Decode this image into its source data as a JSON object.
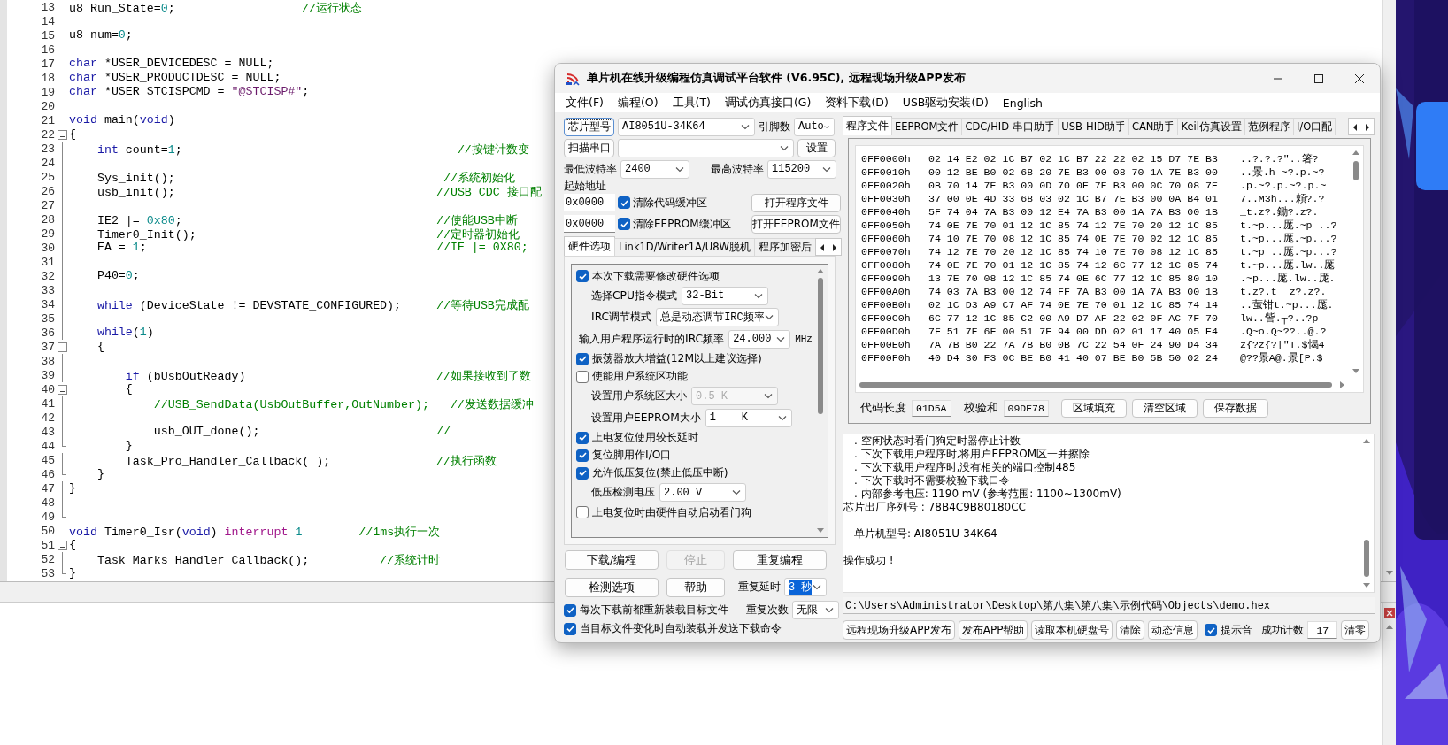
{
  "editor": {
    "lines": [
      {
        "number": "13",
        "tokens": [
          {
            "kind": "plain",
            "text": "u8 Run_State="
          },
          {
            "kind": "num",
            "text": "0"
          },
          {
            "kind": "plain",
            "text": ";                  "
          },
          {
            "kind": "comment",
            "text": "//运行状态"
          }
        ]
      },
      {
        "number": "14"
      },
      {
        "number": "15",
        "tokens": [
          {
            "kind": "plain",
            "text": "u8 num="
          },
          {
            "kind": "num",
            "text": "0"
          },
          {
            "kind": "plain",
            "text": ";"
          }
        ]
      },
      {
        "number": "16"
      },
      {
        "number": "17",
        "tokens": [
          {
            "kind": "kw",
            "text": "char"
          },
          {
            "kind": "plain",
            "text": " *USER_DEVICEDESC = NULL;"
          }
        ]
      },
      {
        "number": "18",
        "tokens": [
          {
            "kind": "kw",
            "text": "char"
          },
          {
            "kind": "plain",
            "text": " *USER_PRODUCTDESC = NULL;"
          }
        ]
      },
      {
        "number": "19",
        "tokens": [
          {
            "kind": "kw",
            "text": "char"
          },
          {
            "kind": "plain",
            "text": " *USER_STCISPCMD = "
          },
          {
            "kind": "str",
            "text": "\"@STCISP#\""
          },
          {
            "kind": "plain",
            "text": ";"
          }
        ]
      },
      {
        "number": "20"
      },
      {
        "number": "21",
        "tokens": [
          {
            "kind": "kw",
            "text": "void"
          },
          {
            "kind": "plain",
            "text": " main("
          },
          {
            "kind": "kw",
            "text": "void"
          },
          {
            "kind": "plain",
            "text": ")"
          }
        ]
      },
      {
        "number": "22",
        "kind": "open",
        "tokens": [
          {
            "kind": "plain",
            "text": "{"
          }
        ]
      },
      {
        "number": "23",
        "kind": "inside",
        "tokens": [
          {
            "kind": "kw",
            "text": "    int"
          },
          {
            "kind": "plain",
            "text": " count="
          },
          {
            "kind": "num",
            "text": "1"
          },
          {
            "kind": "plain",
            "text": ";                                       "
          },
          {
            "kind": "comment",
            "text": "//按键计数变"
          }
        ]
      },
      {
        "number": "24",
        "kind": "inside"
      },
      {
        "number": "25",
        "kind": "inside",
        "tokens": [
          {
            "kind": "plain",
            "text": "    Sys_init();                                      "
          },
          {
            "kind": "comment",
            "text": "//系统初始化"
          }
        ]
      },
      {
        "number": "26",
        "kind": "inside",
        "tokens": [
          {
            "kind": "plain",
            "text": "    usb_init();                                     "
          },
          {
            "kind": "comment",
            "text": "//USB CDC 接口配"
          }
        ]
      },
      {
        "number": "27",
        "kind": "inside"
      },
      {
        "number": "28",
        "kind": "inside",
        "tokens": [
          {
            "kind": "plain",
            "text": "    IE2 |= "
          },
          {
            "kind": "num",
            "text": "0x80"
          },
          {
            "kind": "plain",
            "text": ";                                    "
          },
          {
            "kind": "comment",
            "text": "//使能USB中断"
          }
        ]
      },
      {
        "number": "29",
        "kind": "inside",
        "tokens": [
          {
            "kind": "plain",
            "text": "    Timer0_Init();                                  "
          },
          {
            "kind": "comment",
            "text": "//定时器初始化"
          }
        ]
      },
      {
        "number": "30",
        "kind": "inside",
        "tokens": [
          {
            "kind": "plain",
            "text": "    EA = "
          },
          {
            "kind": "num",
            "text": "1"
          },
          {
            "kind": "plain",
            "text": ";                                         "
          },
          {
            "kind": "comment",
            "text": "//IE |= 0X80;"
          }
        ]
      },
      {
        "number": "31",
        "kind": "inside"
      },
      {
        "number": "32",
        "kind": "inside",
        "tokens": [
          {
            "kind": "plain",
            "text": "    P40="
          },
          {
            "kind": "num",
            "text": "0"
          },
          {
            "kind": "plain",
            "text": ";"
          }
        ]
      },
      {
        "number": "33",
        "kind": "inside"
      },
      {
        "number": "34",
        "kind": "inside",
        "tokens": [
          {
            "kind": "kw",
            "text": "    while"
          },
          {
            "kind": "plain",
            "text": " (DeviceState != DEVSTATE_CONFIGURED);     "
          },
          {
            "kind": "comment",
            "text": "//等待USB完成配"
          }
        ]
      },
      {
        "number": "35",
        "kind": "inside"
      },
      {
        "number": "36",
        "kind": "inside",
        "tokens": [
          {
            "kind": "kw",
            "text": "    while"
          },
          {
            "kind": "plain",
            "text": "("
          },
          {
            "kind": "num",
            "text": "1"
          },
          {
            "kind": "plain",
            "text": ")"
          }
        ]
      },
      {
        "number": "37",
        "kind": "open",
        "tokens": [
          {
            "kind": "plain",
            "text": "    {"
          }
        ]
      },
      {
        "number": "38",
        "kind": "inside"
      },
      {
        "number": "39",
        "kind": "inside",
        "tokens": [
          {
            "kind": "kw",
            "text": "        if"
          },
          {
            "kind": "plain",
            "text": " (bUsbOutReady)                           "
          },
          {
            "kind": "comment",
            "text": "//如果接收到了数"
          }
        ]
      },
      {
        "number": "40",
        "kind": "open",
        "tokens": [
          {
            "kind": "plain",
            "text": "        {"
          }
        ]
      },
      {
        "number": "41",
        "kind": "inside",
        "tokens": [
          {
            "kind": "comment",
            "text": "            //USB_SendData(UsbOutBuffer,OutNumber);   //发送数据缓冲"
          }
        ]
      },
      {
        "number": "42",
        "kind": "inside"
      },
      {
        "number": "43",
        "kind": "inside",
        "tokens": [
          {
            "kind": "plain",
            "text": "            usb_OUT_done();                         "
          },
          {
            "kind": "comment",
            "text": "//"
          }
        ]
      },
      {
        "number": "44",
        "kind": "close",
        "tokens": [
          {
            "kind": "plain",
            "text": "        }"
          }
        ]
      },
      {
        "number": "45",
        "kind": "inside",
        "tokens": [
          {
            "kind": "plain",
            "text": "        Task_Pro_Handler_Callback( );               "
          },
          {
            "kind": "comment",
            "text": "//执行函数"
          }
        ]
      },
      {
        "number": "46",
        "kind": "close",
        "tokens": [
          {
            "kind": "plain",
            "text": "    }"
          }
        ]
      },
      {
        "number": "47",
        "kind": "inside",
        "tokens": [
          {
            "kind": "plain",
            "text": "}"
          }
        ]
      },
      {
        "number": "48",
        "kind": "inside"
      },
      {
        "number": "49",
        "kind": "close"
      },
      {
        "number": "50",
        "tokens": [
          {
            "kind": "kw",
            "text": "void"
          },
          {
            "kind": "plain",
            "text": " Timer0_Isr("
          },
          {
            "kind": "kw",
            "text": "void"
          },
          {
            "kind": "plain",
            "text": ") "
          },
          {
            "kind": "kw2",
            "text": "interrupt"
          },
          {
            "kind": "num",
            "text": " 1"
          },
          {
            "kind": "comment",
            "text": "        //1ms执行一次"
          }
        ]
      },
      {
        "number": "51",
        "kind": "open",
        "tokens": [
          {
            "kind": "plain",
            "text": "{"
          }
        ]
      },
      {
        "number": "52",
        "kind": "inside",
        "tokens": [
          {
            "kind": "plain",
            "text": "    Task_Marks_Handler_Callback();          "
          },
          {
            "kind": "comment",
            "text": "//系统计时"
          }
        ]
      },
      {
        "number": "53",
        "kind": "close",
        "tokens": [
          {
            "kind": "plain",
            "text": "}"
          }
        ]
      }
    ]
  },
  "programmer": {
    "title": "单片机在线升级编程仿真调试平台软件 (V6.95C), 远程现场升级APP发布",
    "menu": [
      "文件(F)",
      "编程(O)",
      "工具(T)",
      "调试仿真接口(G)",
      "资料下载(D)",
      "USB驱动安装(D)",
      "English"
    ],
    "chip": {
      "button": "芯片型号",
      "model": "AI8051U-34K64",
      "pins_label": "引脚数",
      "pins": "Auto"
    },
    "port": {
      "button": "扫描串口",
      "settings_button": "设置"
    },
    "baud": {
      "min_label": "最低波特率",
      "min": "2400",
      "max_label": "最高波特率",
      "max": "115200"
    },
    "start_address": {
      "label": "起始地址",
      "rows": [
        {
          "address": "0x0000",
          "option": "清除代码缓冲区",
          "checked": true,
          "button": "打开程序文件"
        },
        {
          "address": "0x0000",
          "option": "清除EEPROM缓冲区",
          "checked": true,
          "button": "打开EEPROM文件"
        }
      ]
    },
    "option_tabs": [
      {
        "label": "硬件选项",
        "selected": true
      },
      {
        "label": "Link1D/Writer1A/U8W脱机",
        "selected": false
      },
      {
        "label": "程序加密后",
        "selected": false
      }
    ],
    "hardware_options": [
      {
        "kind": "checkbox",
        "label": "本次下载需要修改硬件选项",
        "checked": true
      },
      {
        "kind": "select",
        "label": "选择CPU指令模式",
        "value": "32-Bit",
        "disabled": false
      },
      {
        "kind": "select",
        "label": "IRC调节模式",
        "value": "总是动态调节IRC频率",
        "disabled": false
      },
      {
        "kind": "select",
        "label": "输入用户程序运行时的IRC频率",
        "value": "24.000",
        "unit": "MHz",
        "disabled": false
      },
      {
        "kind": "checkbox",
        "label": "振荡器放大增益(12M以上建议选择)",
        "checked": true
      },
      {
        "kind": "checkbox",
        "label": "使能用户系统区功能",
        "checked": false
      },
      {
        "kind": "select",
        "label": "设置用户系统区大小",
        "value": "0.5 K",
        "disabled": true
      },
      {
        "kind": "select",
        "label": "设置用户EEPROM大小",
        "value": "1    K",
        "disabled": false
      },
      {
        "kind": "checkbox",
        "label": "上电复位使用较长延时",
        "checked": true
      },
      {
        "kind": "checkbox",
        "label": "复位脚用作I/O口",
        "checked": true
      },
      {
        "kind": "checkbox",
        "label": "允许低压复位(禁止低压中断)",
        "checked": true
      },
      {
        "kind": "select",
        "label": "低压检测电压",
        "value": "2.00 V",
        "disabled": false
      },
      {
        "kind": "checkbox",
        "label": "上电复位时由硬件自动启动看门狗",
        "checked": false
      }
    ],
    "actions": [
      {
        "label": "下载/编程",
        "disabled": false
      },
      {
        "label": "停止",
        "disabled": true
      },
      {
        "label": "重复编程",
        "disabled": false
      },
      {
        "label": "检测选项",
        "disabled": false
      },
      {
        "label": "帮助",
        "disabled": false
      }
    ],
    "repeat_delay": {
      "label": "重复延时",
      "value": "3 秒",
      "highlighted": true
    },
    "repeat_count": {
      "label": "重复次数",
      "value": "无限"
    },
    "reload_options": [
      {
        "label": "每次下载前都重新装载目标文件",
        "checked": true
      },
      {
        "label": "当目标文件变化时自动装载并发送下载命令",
        "checked": true
      }
    ],
    "file_tabs": [
      {
        "label": "程序文件",
        "selected": true
      },
      {
        "label": "EEPROM文件",
        "selected": false
      },
      {
        "label": "CDC/HID-串口助手",
        "selected": false
      },
      {
        "label": "USB-HID助手",
        "selected": false
      },
      {
        "label": "CAN助手",
        "selected": false
      },
      {
        "label": "Keil仿真设置",
        "selected": false
      },
      {
        "label": "范例程序",
        "selected": false
      },
      {
        "label": "I/O口配",
        "selected": false
      }
    ],
    "hex": {
      "rows": [
        {
          "address": "0FF0000h",
          "bytes": "02 14 E2 02 1C B7 02 1C B7 22 22 02 15 D7 7E B3",
          "ascii": "..?.?.?\"..箸?"
        },
        {
          "address": "0FF0010h",
          "bytes": "00 12 BE B0 02 68 20 7E B3 00 08 70 1A 7E B3 00",
          "ascii": "..景.h ~?.p.~?"
        },
        {
          "address": "0FF0020h",
          "bytes": "0B 70 14 7E B3 00 0D 70 0E 7E B3 00 0C 70 08 7E",
          "ascii": ".p.~?.p.~?.p.~"
        },
        {
          "address": "0FF0030h",
          "bytes": "37 00 0E 4D 33 68 03 02 1C B7 7E B3 00 0A B4 01",
          "ascii": "7..M3h...頼?.?"
        },
        {
          "address": "0FF0040h",
          "bytes": "5F 74 04 7A B3 00 12 E4 7A B3 00 1A 7A B3 00 1B",
          "ascii": "_t.z?.鋤?.z?."
        },
        {
          "address": "0FF0050h",
          "bytes": "74 0E 7E 70 01 12 1C 85 74 12 7E 70 20 12 1C 85",
          "ascii": "t.~p...厖.~p ..?"
        },
        {
          "address": "0FF0060h",
          "bytes": "74 10 7E 70 08 12 1C 85 74 0E 7E 70 02 12 1C 85",
          "ascii": "t.~p...厖.~p...?"
        },
        {
          "address": "0FF0070h",
          "bytes": "74 12 7E 70 20 12 1C 85 74 10 7E 70 08 12 1C 85",
          "ascii": "t.~p ..厖.~p...?"
        },
        {
          "address": "0FF0080h",
          "bytes": "74 0E 7E 70 01 12 1C 85 74 12 6C 77 12 1C 85 74",
          "ascii": "t.~p...厖.lw..厖"
        },
        {
          "address": "0FF0090h",
          "bytes": "13 7E 70 08 12 1C 85 74 0E 6C 77 12 1C 85 80 10",
          "ascii": ".~p...厖.lw..厐."
        },
        {
          "address": "0FF00A0h",
          "bytes": "74 03 7A B3 00 12 74 FF 7A B3 00 1A 7A B3 00 1B",
          "ascii": "t.z?.t  z?.z?."
        },
        {
          "address": "0FF00B0h",
          "bytes": "02 1C D3 A9 C7 AF 74 0E 7E 70 01 12 1C 85 74 14",
          "ascii": "..萤钳t.~p...厖."
        },
        {
          "address": "0FF00C0h",
          "bytes": "6C 77 12 1C 85 C2 00 A9 D7 AF 22 02 0F AC 7F 70",
          "ascii": "lw..訾.┬?..?p"
        },
        {
          "address": "0FF00D0h",
          "bytes": "7F 51 7E 6F 00 51 7E 94 00 DD 02 01 17 40 05 E4",
          "ascii": ".Q~o.Q~??..@.?"
        },
        {
          "address": "0FF00E0h",
          "bytes": "7A 7B B0 22 7A 7B B0 0B 7C 22 54 0F 24 90 D4 34",
          "ascii": "z{?z{?|\"T.$愒4"
        },
        {
          "address": "0FF00F0h",
          "bytes": "40 D4 30 F3 0C BE B0 41 40 07 BE B0 5B 50 02 24",
          "ascii": "@??景A@.景[P.$"
        }
      ],
      "code_length_label": "代码长度",
      "code_length": "01D5A",
      "checksum_label": "校验和",
      "checksum": "09DE78",
      "buttons": [
        "区域填充",
        "清空区域",
        "保存数据"
      ]
    },
    "log": [
      {
        "kind": "item",
        "text": ". 空闲状态时看门狗定时器停止计数"
      },
      {
        "kind": "item",
        "text": ". 下次下载用户程序时,将用户EEPROM区一并擦除"
      },
      {
        "kind": "item",
        "text": ". 下次下载用户程序时,没有相关的端口控制485"
      },
      {
        "kind": "item",
        "text": ". 下次下载时不需要校验下载口令"
      },
      {
        "kind": "item",
        "text": ". 内部参考电压: 1190 mV (参考范围: 1100~1300mV)"
      },
      {
        "kind": "plain",
        "text": "芯片出厂序列号 : 78B4C9B80180CC"
      },
      {
        "kind": "model",
        "text": "单片机型号: AI8051U-34K64"
      },
      {
        "kind": "result",
        "text": "操作成功 !"
      }
    ],
    "path": "C:\\Users\\Administrator\\Desktop\\第八集\\第八集\\示例代码\\Objects\\demo.hex",
    "footer": {
      "buttons": [
        "远程现场升级APP发布",
        "发布APP帮助",
        "读取本机硬盘号",
        "清除",
        "动态信息"
      ],
      "sound": {
        "label": "提示音",
        "checked": true
      },
      "count_label": "成功计数",
      "count": "17",
      "reset_button": "清零"
    }
  }
}
